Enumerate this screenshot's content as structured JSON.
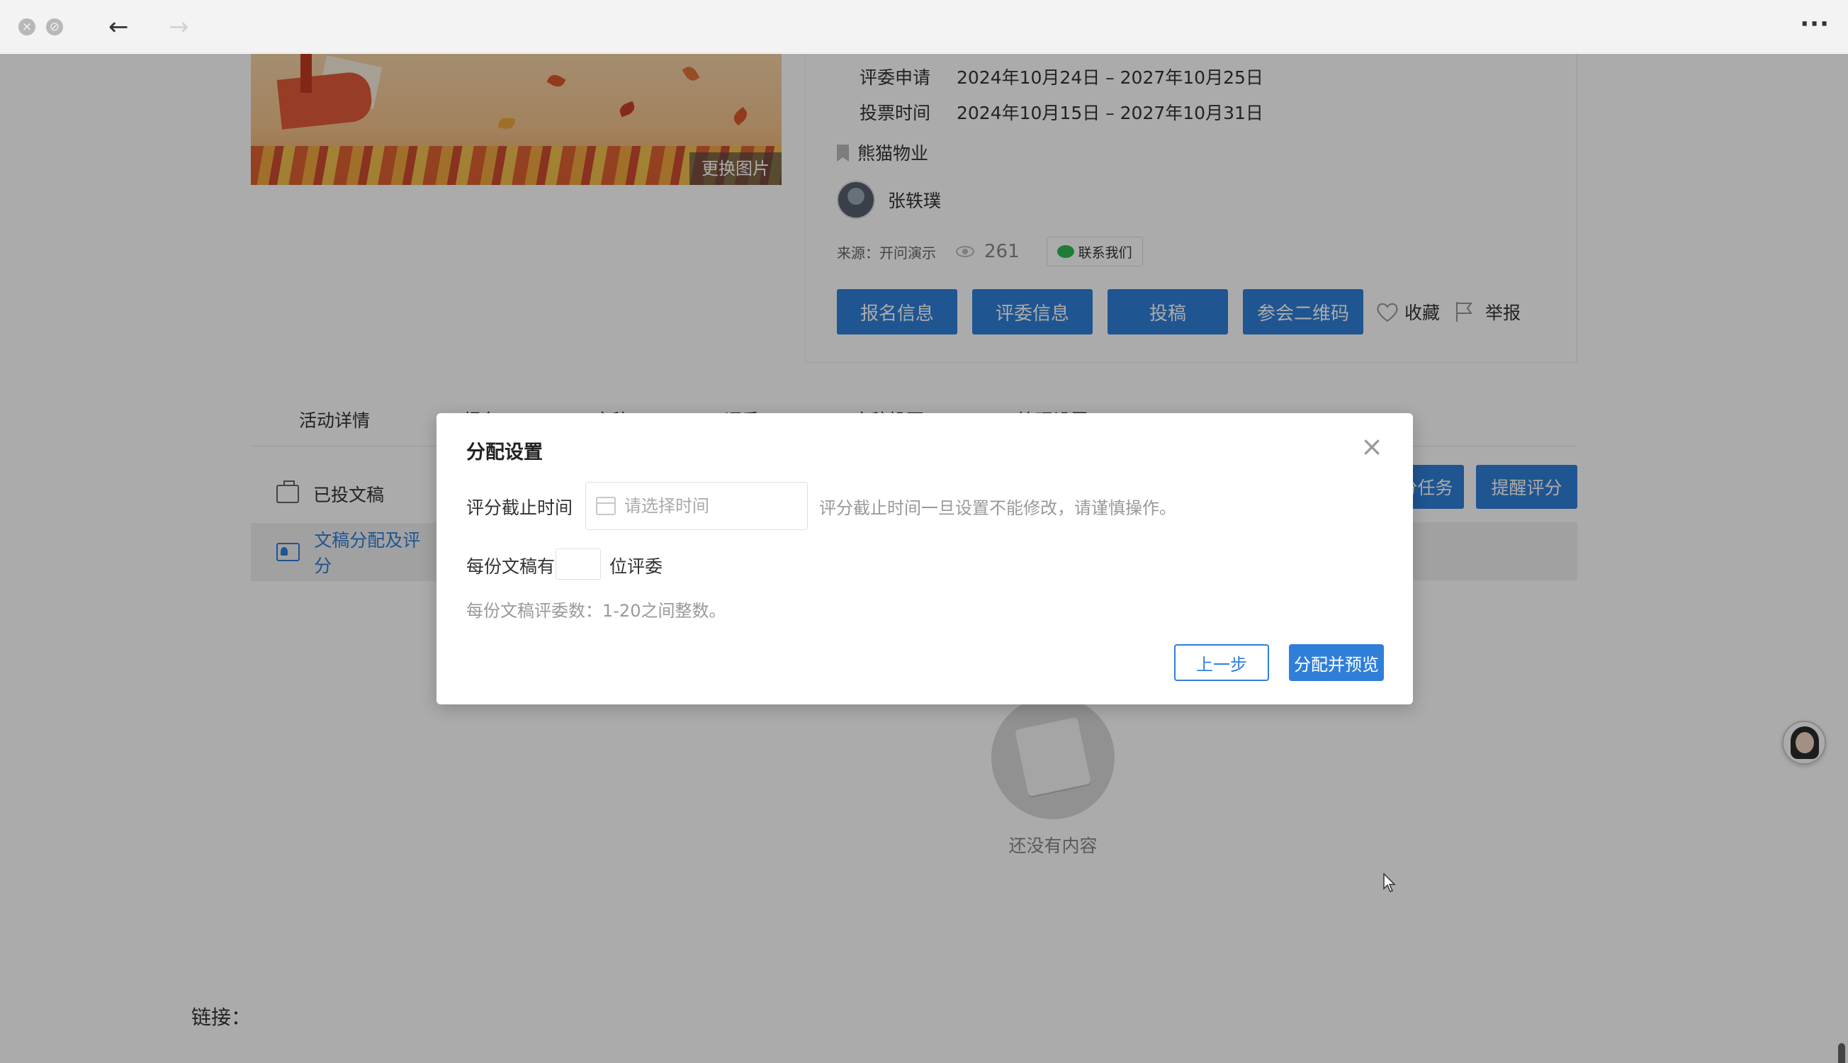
{
  "titlebar": {
    "close_icon": "×",
    "minimize_icon": "⊘",
    "back_icon": "←",
    "forward_icon": "→",
    "more_icon": "···"
  },
  "cover": {
    "change_image_label": "更换图片"
  },
  "activity": {
    "judge_apply_label": "评委申请",
    "judge_apply_value": "2024年10月24日 – 2027年10月25日",
    "vote_time_label": "投票时间",
    "vote_time_value": "2024年10月15日 – 2027年10月31日",
    "organizer": "熊猫物业",
    "author": "张轶璞",
    "source": "来源：开问演示",
    "views": "261",
    "contact_label": "联系我们"
  },
  "actions": {
    "signup_info": "报名信息",
    "judge_info": "评委信息",
    "submit": "投稿",
    "qr_code": "参会二维码",
    "favorite": "收藏",
    "report": "举报"
  },
  "tabs": [
    {
      "label": "活动详情"
    },
    {
      "label": "报名"
    },
    {
      "label": "文稿"
    },
    {
      "label": "评委"
    },
    {
      "label": "文稿投票"
    },
    {
      "label": "管理设置"
    }
  ],
  "side_menu": {
    "submitted": "已投文稿",
    "assign_score": "文稿分配及评分"
  },
  "task_buttons": {
    "assign_task": "分任务",
    "remind_score": "提醒评分"
  },
  "empty_state": {
    "text": "还没有内容"
  },
  "link_label": "链接：",
  "dialog": {
    "title": "分配设置",
    "close_icon": "×",
    "deadline_label": "评分截止时间",
    "deadline_placeholder": "请选择时间",
    "deadline_hint": "评分截止时间一旦设置不能修改，请谨慎操作。",
    "per_doc_prefix": "每份文稿有",
    "per_doc_value": "",
    "per_doc_suffix": "位评委",
    "count_hint": "每份文稿评委数：1-20之间整数。",
    "prev_button": "上一步",
    "assign_button": "分配并预览"
  },
  "colors": {
    "primary": "#2f7fd9",
    "overlay": "rgba(0,0,0,0.33)"
  }
}
